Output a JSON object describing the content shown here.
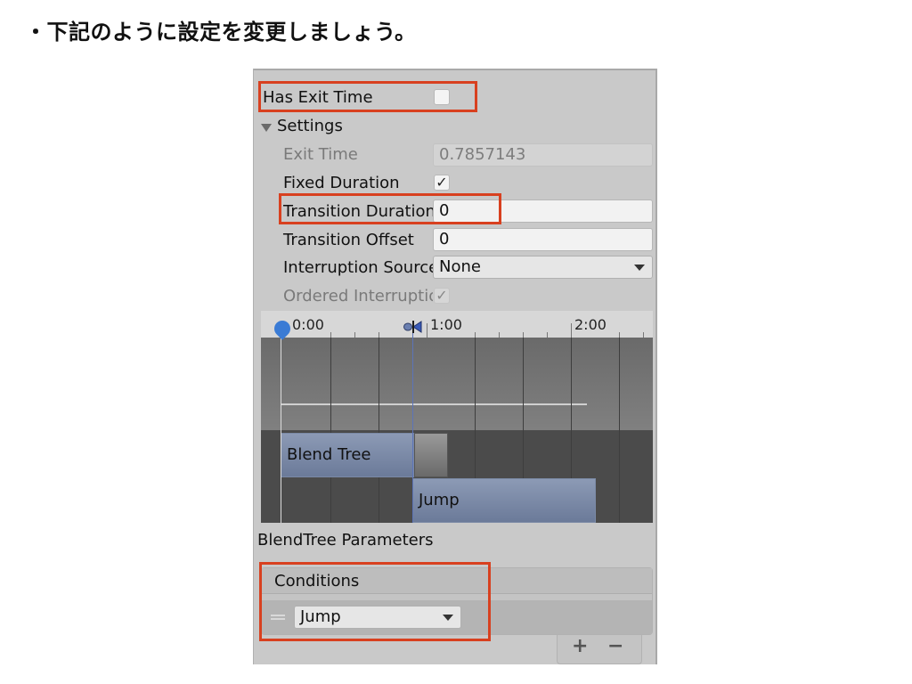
{
  "slide": {
    "title": "・下記のように設定を変更しましょう。"
  },
  "inspector": {
    "has_exit_time": {
      "label": "Has Exit Time",
      "checked": false
    },
    "settings": {
      "label": "Settings",
      "exit_time": {
        "label": "Exit Time",
        "value": "0.7857143"
      },
      "fixed_duration": {
        "label": "Fixed Duration",
        "checked": true
      },
      "transition_duration": {
        "label": "Transition Duration",
        "value": "0"
      },
      "transition_offset": {
        "label": "Transition Offset",
        "value": "0"
      },
      "interruption_source": {
        "label": "Interruption Source",
        "value": "None"
      },
      "ordered_interruption": {
        "label": "Ordered Interruption",
        "checked": true
      }
    },
    "timeline": {
      "ruler_labels": [
        "0:00",
        "1:00",
        "2:00"
      ],
      "clips": [
        {
          "name": "Blend Tree"
        },
        {
          "name": "Jump"
        }
      ]
    },
    "blendtree_parameters_label": "BlendTree Parameters",
    "conditions": {
      "header": "Conditions",
      "items": [
        {
          "parameter": "Jump"
        }
      ],
      "add_label": "+",
      "remove_label": "−"
    }
  },
  "annotation_color": "#d8401f",
  "icons": [
    "foldout-arrow-icon",
    "checkmark-icon",
    "dropdown-caret-icon",
    "drag-handle-icon",
    "start-marker-icon",
    "transition-marker-icon"
  ]
}
